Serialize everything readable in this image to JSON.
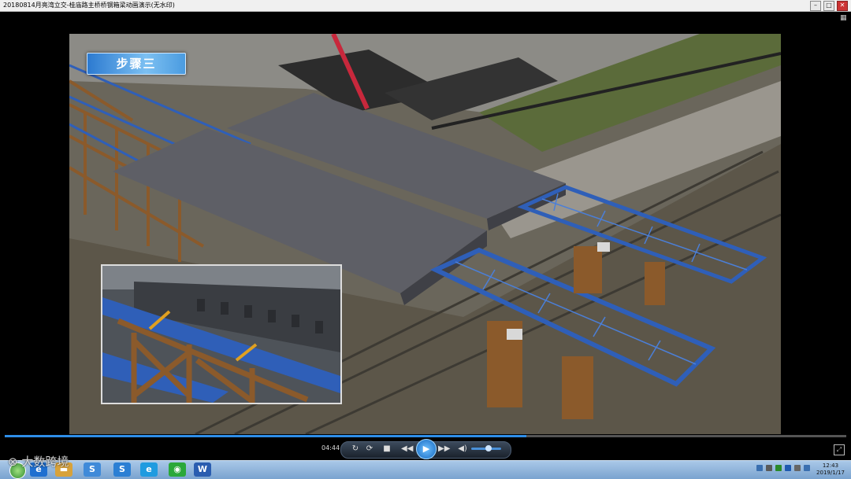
{
  "window": {
    "title": "20180814月亮湾立交-桂庙路主桥桥钢箱梁动画演示(无水印)",
    "buttons": [
      "minimize",
      "maximize",
      "close"
    ]
  },
  "video": {
    "step_label": "步骤三"
  },
  "player": {
    "current_time": "04:44",
    "progress": 0.62,
    "volume": 0.6,
    "buttons": [
      "repeat-icon",
      "refresh-icon",
      "stop-icon",
      "rewind-icon",
      "play-icon",
      "fast-forward-icon",
      "volume-icon",
      "fullscreen-icon"
    ]
  },
  "watermark": {
    "text": "大数跨境"
  },
  "taskbar": {
    "apps": [
      "ie-icon",
      "folder-icon",
      "sogou-icon",
      "browser-icon",
      "wechat-icon",
      "word-icon"
    ],
    "clock_time": "12:43",
    "clock_date": "2019/1/17"
  },
  "colors": {
    "progress": "#2e8ee8",
    "steel_blue": "#2f5fb8",
    "pier_brown": "#8b5a2b",
    "deck_gray": "#5e5f66"
  }
}
